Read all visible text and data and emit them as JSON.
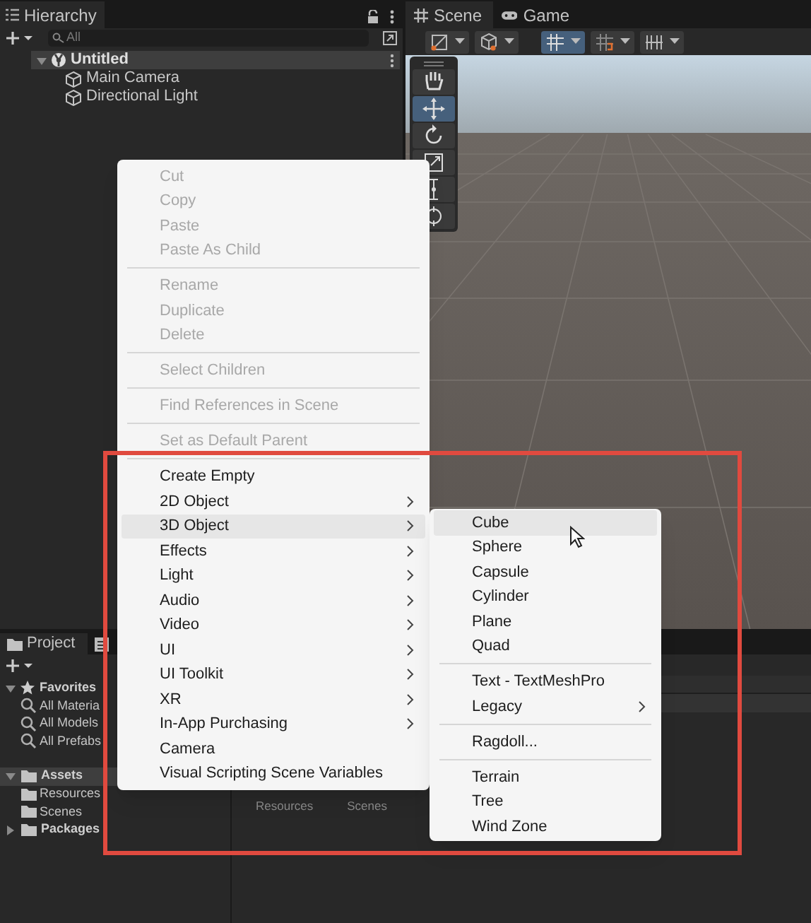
{
  "hierarchy": {
    "tab": {
      "label": "Hierarchy",
      "selected": true
    },
    "search": {
      "placeholder": "All"
    },
    "scene": {
      "name": "Untitled",
      "expanded": true,
      "children": [
        {
          "name": "Main Camera"
        },
        {
          "name": "Directional Light"
        }
      ]
    }
  },
  "scene_view": {
    "tabs": [
      {
        "label": "Scene",
        "selected": true,
        "kind": "scene"
      },
      {
        "label": "Game",
        "selected": false,
        "kind": "game"
      }
    ],
    "toolbar": [
      {
        "kind": "draw-mode",
        "selected": false
      },
      {
        "kind": "gizmo",
        "selected": false
      },
      {
        "kind": "grid",
        "selected": true
      },
      {
        "kind": "snap",
        "selected": false
      },
      {
        "kind": "increment",
        "selected": false
      }
    ],
    "tools": [
      {
        "kind": "hand",
        "selected": false
      },
      {
        "kind": "move",
        "selected": true
      },
      {
        "kind": "rotate",
        "selected": false
      },
      {
        "kind": "scale",
        "selected": false
      },
      {
        "kind": "rect",
        "selected": false
      },
      {
        "kind": "transform",
        "selected": false
      }
    ]
  },
  "project": {
    "tabs": [
      {
        "kind": "project",
        "label": "Project",
        "selected": true
      },
      {
        "kind": "console",
        "selected": false
      }
    ],
    "tree": [
      {
        "name": "Favorites",
        "kind": "favorites",
        "expanded": true,
        "selected": false,
        "children": [
          {
            "name": "All Materia",
            "kind": "search"
          },
          {
            "name": "All Models",
            "kind": "search"
          },
          {
            "name": "All Prefabs",
            "kind": "search"
          }
        ]
      },
      {
        "name": "Assets",
        "kind": "folder",
        "expanded": true,
        "selected": true,
        "children": [
          {
            "name": "Resources",
            "kind": "folder"
          },
          {
            "name": "Scenes",
            "kind": "folder"
          }
        ]
      },
      {
        "name": "Packages",
        "kind": "folder",
        "expanded": false,
        "selected": false
      }
    ],
    "grid_items": [
      {
        "label": "Resources"
      },
      {
        "label": "Scenes"
      }
    ]
  },
  "context_menu": {
    "items": [
      {
        "kind": "item",
        "label": "Cut",
        "disabled": true
      },
      {
        "kind": "item",
        "label": "Copy",
        "disabled": true
      },
      {
        "kind": "item",
        "label": "Paste",
        "disabled": true
      },
      {
        "kind": "item",
        "label": "Paste As Child",
        "disabled": true
      },
      {
        "kind": "separator"
      },
      {
        "kind": "item",
        "label": "Rename",
        "disabled": true
      },
      {
        "kind": "item",
        "label": "Duplicate",
        "disabled": true
      },
      {
        "kind": "item",
        "label": "Delete",
        "disabled": true
      },
      {
        "kind": "separator"
      },
      {
        "kind": "item",
        "label": "Select Children",
        "disabled": true
      },
      {
        "kind": "separator"
      },
      {
        "kind": "item",
        "label": "Find References in Scene",
        "disabled": true
      },
      {
        "kind": "separator"
      },
      {
        "kind": "item",
        "label": "Set as Default Parent",
        "disabled": true
      },
      {
        "kind": "separator"
      },
      {
        "kind": "item",
        "label": "Create Empty",
        "disabled": false
      },
      {
        "kind": "item",
        "label": "2D Object",
        "disabled": false,
        "submenu": true
      },
      {
        "kind": "item",
        "label": "3D Object",
        "disabled": false,
        "submenu": true,
        "selected": true
      },
      {
        "kind": "item",
        "label": "Effects",
        "disabled": false,
        "submenu": true
      },
      {
        "kind": "item",
        "label": "Light",
        "disabled": false,
        "submenu": true
      },
      {
        "kind": "item",
        "label": "Audio",
        "disabled": false,
        "submenu": true
      },
      {
        "kind": "item",
        "label": "Video",
        "disabled": false,
        "submenu": true
      },
      {
        "kind": "item",
        "label": "UI",
        "disabled": false,
        "submenu": true
      },
      {
        "kind": "item",
        "label": "UI Toolkit",
        "disabled": false,
        "submenu": true
      },
      {
        "kind": "item",
        "label": "XR",
        "disabled": false,
        "submenu": true
      },
      {
        "kind": "item",
        "label": "In-App Purchasing",
        "disabled": false,
        "submenu": true
      },
      {
        "kind": "item",
        "label": "Camera",
        "disabled": false
      },
      {
        "kind": "item",
        "label": "Visual Scripting Scene Variables",
        "disabled": false
      }
    ]
  },
  "submenu": {
    "items": [
      {
        "kind": "item",
        "label": "Cube",
        "selected": true
      },
      {
        "kind": "item",
        "label": "Sphere"
      },
      {
        "kind": "item",
        "label": "Capsule"
      },
      {
        "kind": "item",
        "label": "Cylinder"
      },
      {
        "kind": "item",
        "label": "Plane"
      },
      {
        "kind": "item",
        "label": "Quad"
      },
      {
        "kind": "separator"
      },
      {
        "kind": "item",
        "label": "Text - TextMeshPro"
      },
      {
        "kind": "item",
        "label": "Legacy",
        "submenu": true
      },
      {
        "kind": "separator"
      },
      {
        "kind": "item",
        "label": "Ragdoll..."
      },
      {
        "kind": "separator"
      },
      {
        "kind": "item",
        "label": "Terrain"
      },
      {
        "kind": "item",
        "label": "Tree"
      },
      {
        "kind": "item",
        "label": "Wind Zone"
      }
    ]
  }
}
